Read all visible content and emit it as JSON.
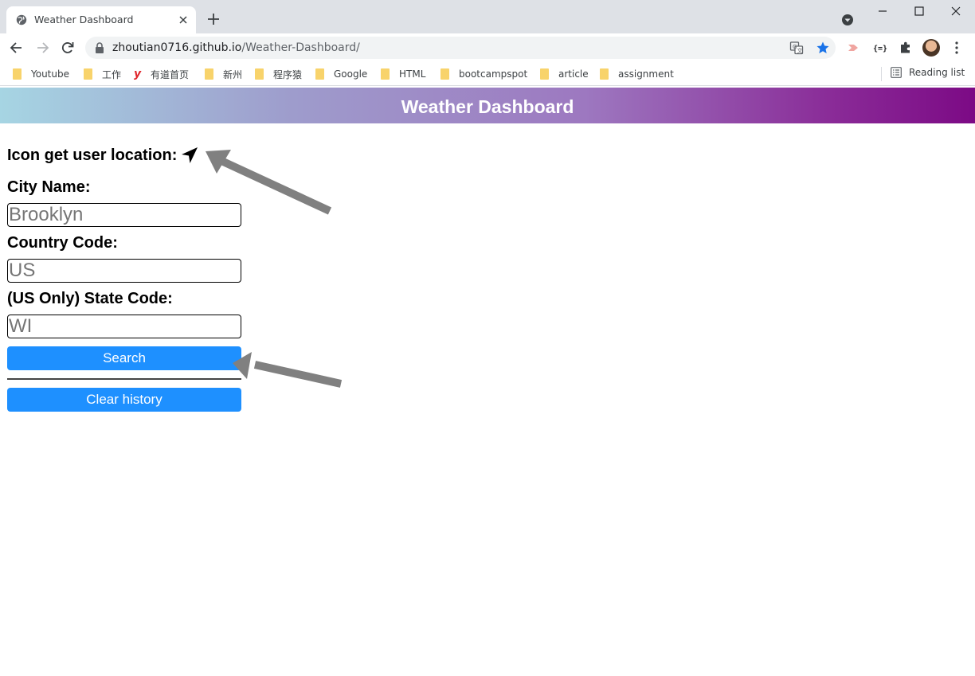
{
  "browser": {
    "tab": {
      "title": "Weather Dashboard"
    },
    "url": {
      "domain": "zhoutian0716.github.io",
      "path": "/Weather-Dashboard/"
    },
    "bookmarks": [
      "Youtube",
      "工作",
      "有道首页",
      "新州",
      "程序猿",
      "Google",
      "HTML",
      "bootcampspot",
      "article",
      "assignment"
    ],
    "reading_list": "Reading list"
  },
  "page": {
    "banner_title": "Weather Dashboard",
    "location_label": "Icon get user location:",
    "fields": {
      "city": {
        "label": "City Name:",
        "placeholder": "Brooklyn",
        "value": ""
      },
      "country": {
        "label": "Country Code:",
        "placeholder": "US",
        "value": ""
      },
      "state": {
        "label": "(US Only) State Code:",
        "placeholder": "WI",
        "value": ""
      }
    },
    "search_label": "Search",
    "clear_label": "Clear history"
  },
  "colors": {
    "button": "#1e90ff",
    "banner_start": "#a6d5e3",
    "banner_end": "#7c0a85",
    "annotation_arrow": "#808080"
  }
}
